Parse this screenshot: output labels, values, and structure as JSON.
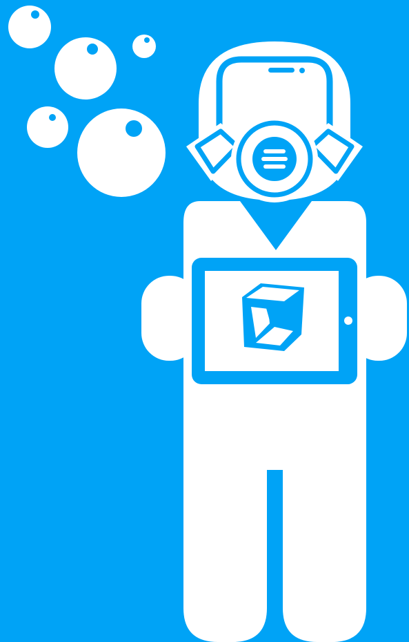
{
  "illustration": {
    "subject": "diver-holding-tablet",
    "icons": [
      "bubble-icon",
      "diving-helmet-icon",
      "tablet-icon",
      "cube-logo-icon"
    ]
  },
  "colors": {
    "background": "#00A3F6",
    "foreground": "#FFFFFF"
  }
}
